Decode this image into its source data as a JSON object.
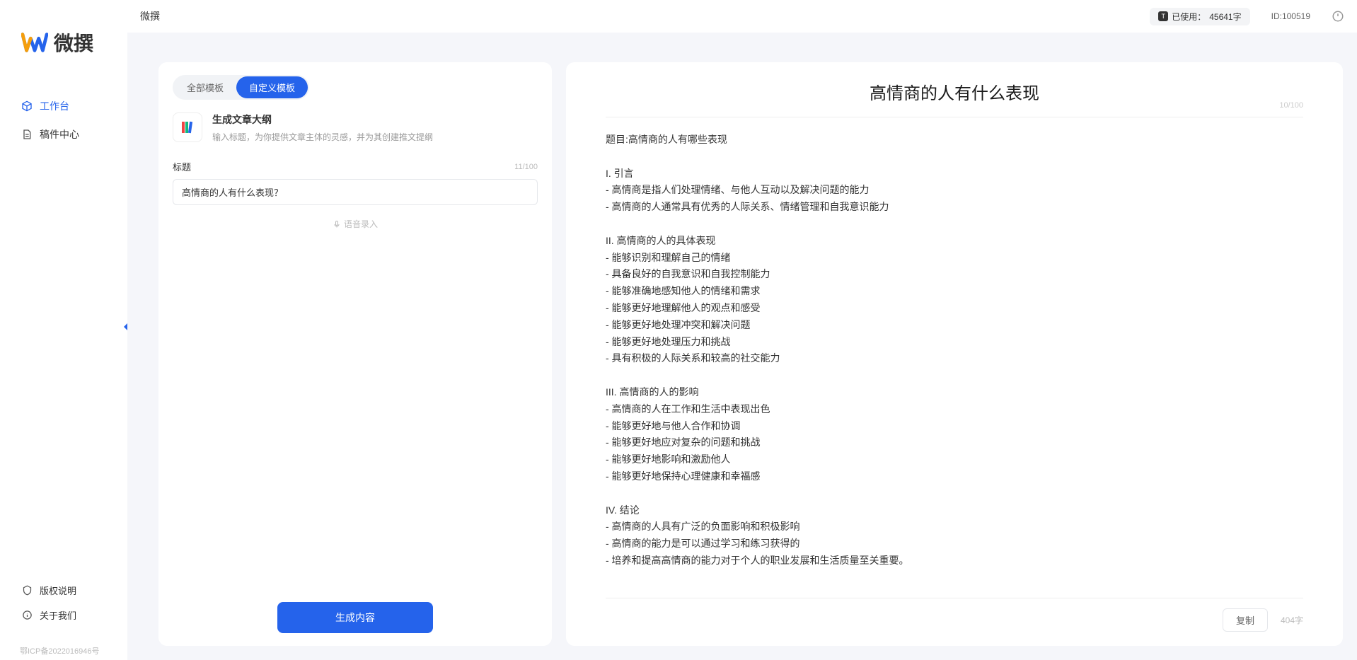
{
  "brand": "微撰",
  "topbar": {
    "title": "微撰",
    "usage_label": "已使用：",
    "usage_value": "45641字",
    "user_id_label": "ID:",
    "user_id": "100519"
  },
  "sidebar": {
    "nav": [
      {
        "label": "工作台",
        "icon": "cube"
      },
      {
        "label": "稿件中心",
        "icon": "doc"
      }
    ],
    "bottom": [
      {
        "label": "版权说明",
        "icon": "shield"
      },
      {
        "label": "关于我们",
        "icon": "info"
      }
    ],
    "icp": "鄂ICP备2022016946号"
  },
  "left": {
    "tabs": [
      {
        "label": "全部模板",
        "active": false
      },
      {
        "label": "自定义模板",
        "active": true
      }
    ],
    "template": {
      "title": "生成文章大纲",
      "desc": "输入标题，为你提供文章主体的灵感，并为其创建推文提纲"
    },
    "field_label": "标题",
    "field_count": "11/100",
    "input_value": "高情商的人有什么表现？",
    "voice_label": "语音录入",
    "generate": "生成内容"
  },
  "right": {
    "title": "高情商的人有什么表现",
    "title_count": "10/100",
    "body": "题目:高情商的人有哪些表现\n\nI. 引言\n- 高情商是指人们处理情绪、与他人互动以及解决问题的能力\n- 高情商的人通常具有优秀的人际关系、情绪管理和自我意识能力\n\nII. 高情商的人的具体表现\n- 能够识别和理解自己的情绪\n- 具备良好的自我意识和自我控制能力\n- 能够准确地感知他人的情绪和需求\n- 能够更好地理解他人的观点和感受\n- 能够更好地处理冲突和解决问题\n- 能够更好地处理压力和挑战\n- 具有积极的人际关系和较高的社交能力\n\nIII. 高情商的人的影响\n- 高情商的人在工作和生活中表现出色\n- 能够更好地与他人合作和协调\n- 能够更好地应对复杂的问题和挑战\n- 能够更好地影响和激励他人\n- 能够更好地保持心理健康和幸福感\n\nIV. 结论\n- 高情商的人具有广泛的负面影响和积极影响\n- 高情商的能力是可以通过学习和练习获得的\n- 培养和提高高情商的能力对于个人的职业发展和生活质量至关重要。",
    "copy": "复制",
    "word_count": "404字"
  }
}
